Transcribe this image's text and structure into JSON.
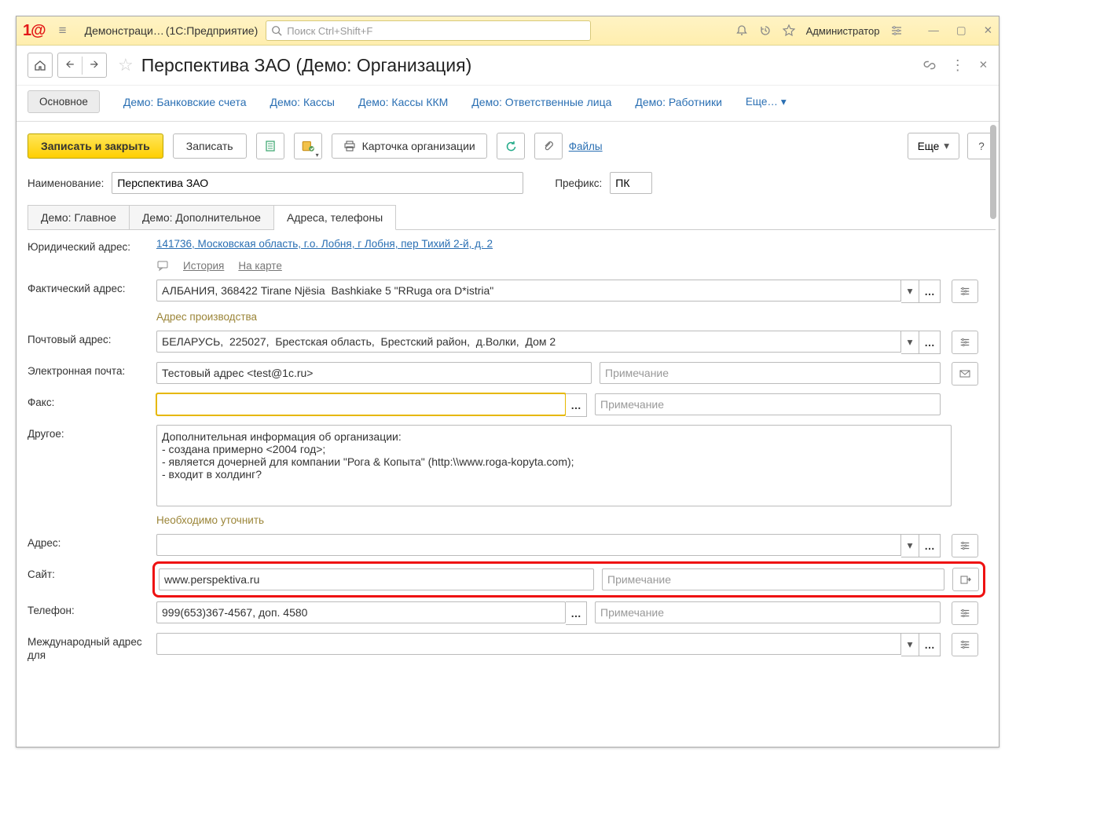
{
  "top": {
    "app_truncated": "Демонстраци…",
    "app_suffix": "(1С:Предприятие)",
    "search_placeholder": "Поиск Ctrl+Shift+F",
    "user": "Администратор"
  },
  "page": {
    "title": "Перспектива ЗАО (Демо: Организация)"
  },
  "linktabs": {
    "main": "Основное",
    "items": [
      "Демо: Банковские счета",
      "Демо: Кассы",
      "Демо: Кассы ККМ",
      "Демо: Ответственные лица",
      "Демо: Работники"
    ],
    "more": "Еще…"
  },
  "toolbar": {
    "save_close": "Записать и закрыть",
    "save": "Записать",
    "card": "Карточка организации",
    "files": "Файлы",
    "more": "Еще"
  },
  "fields": {
    "name_label": "Наименование:",
    "name_value": "Перспектива ЗАО",
    "prefix_label": "Префикс:",
    "prefix_value": "ПК"
  },
  "tabs": {
    "t1": "Демо: Главное",
    "t2": "Демо: Дополнительное",
    "t3": "Адреса, телефоны"
  },
  "addr": {
    "legal_label": "Юридический адрес:",
    "legal_value": "141736, Московская область, г.о. Лобня, г Лобня, пер Тихий 2-й, д. 2",
    "history": "История",
    "onmap": "На карте",
    "actual_label": "Фактический адрес:",
    "actual_value": "АЛБАНИЯ, 368422 Tirane Njёsia  Bashkiake 5 \"RRuga ora D*istria\"",
    "actual_hint": "Адрес производства",
    "post_label": "Почтовый адрес:",
    "post_value": "БЕЛАРУСЬ,  225027,  Брестская область,  Брестский район,  д.Волки,  Дом 2",
    "email_label": "Электронная почта:",
    "email_value": "Тестовый адрес <test@1c.ru>",
    "note_placeholder": "Примечание",
    "fax_label": "Факс:",
    "fax_value": "",
    "other_label": "Другое:",
    "other_value": "Дополнительная информация об организации:\n- создана примерно <2004 год>;\n- является дочерней для компании \"Рога & Копыта\" (http:\\\\www.roga-kopyta.com);\n- входит в холдинг?",
    "other_hint": "Необходимо уточнить",
    "addr2_label": "Адрес:",
    "addr2_value": "",
    "site_label": "Сайт:",
    "site_value": "www.perspektiva.ru",
    "phone_label": "Телефон:",
    "phone_value": "999(653)367-4567, доп. 4580",
    "intl_label": "Международный адрес для"
  }
}
